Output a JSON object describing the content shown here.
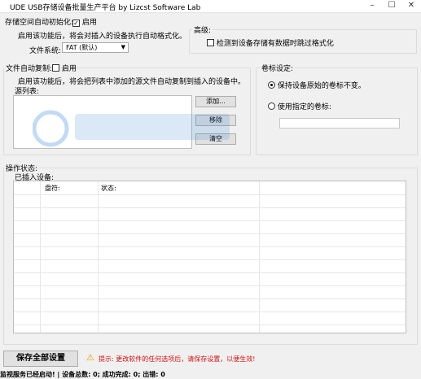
{
  "titlebar": {
    "title": "UDE USB存储设备批量生产平台    by Lizcst Software Lab",
    "min": "–",
    "max": "☐",
    "close": "✕"
  },
  "format": {
    "label": "存储空间自动初始化:",
    "check_mark": "✓",
    "enable_label": "启用",
    "desc": "启用该功能后，将会对插入的设备执行自动格式化。",
    "fs_label": "文件系统:",
    "fs_value": "FAT (默认)",
    "fs_arrow": "▼"
  },
  "advanced": {
    "title": "高级:",
    "skip_label": "检测到设备存储有数据时跳过格式化"
  },
  "copy": {
    "label": "文件自动复制:",
    "enable_label": "启用",
    "desc": "启用该功能后，将会把列表中添加的源文件自动复制到插入的设备中。",
    "source_label": "源列表:",
    "add_label": "添加...",
    "remove_label": "移除",
    "clear_label": "清空"
  },
  "volume": {
    "title": "卷标设定:",
    "keep_label": "保持设备原始的卷标不变。",
    "custom_label": "使用指定的卷标:",
    "custom_value": ""
  },
  "status": {
    "title": "操作状态:",
    "inserted_label": "已插入设备:",
    "columns": [
      "盘符:",
      "状态:"
    ]
  },
  "footer": {
    "save_label": "保存全部设置",
    "warn_icon": "⚠",
    "tip": "提示: 更改软件的任何选项后，请保存设置，以便生效!",
    "statusbar": "监视服务已经启动! | 设备总数: 0; 成功完成: 0; 出错: 0"
  },
  "colors": {
    "warning": "#d01010",
    "warn_icon": "#e8a000"
  }
}
